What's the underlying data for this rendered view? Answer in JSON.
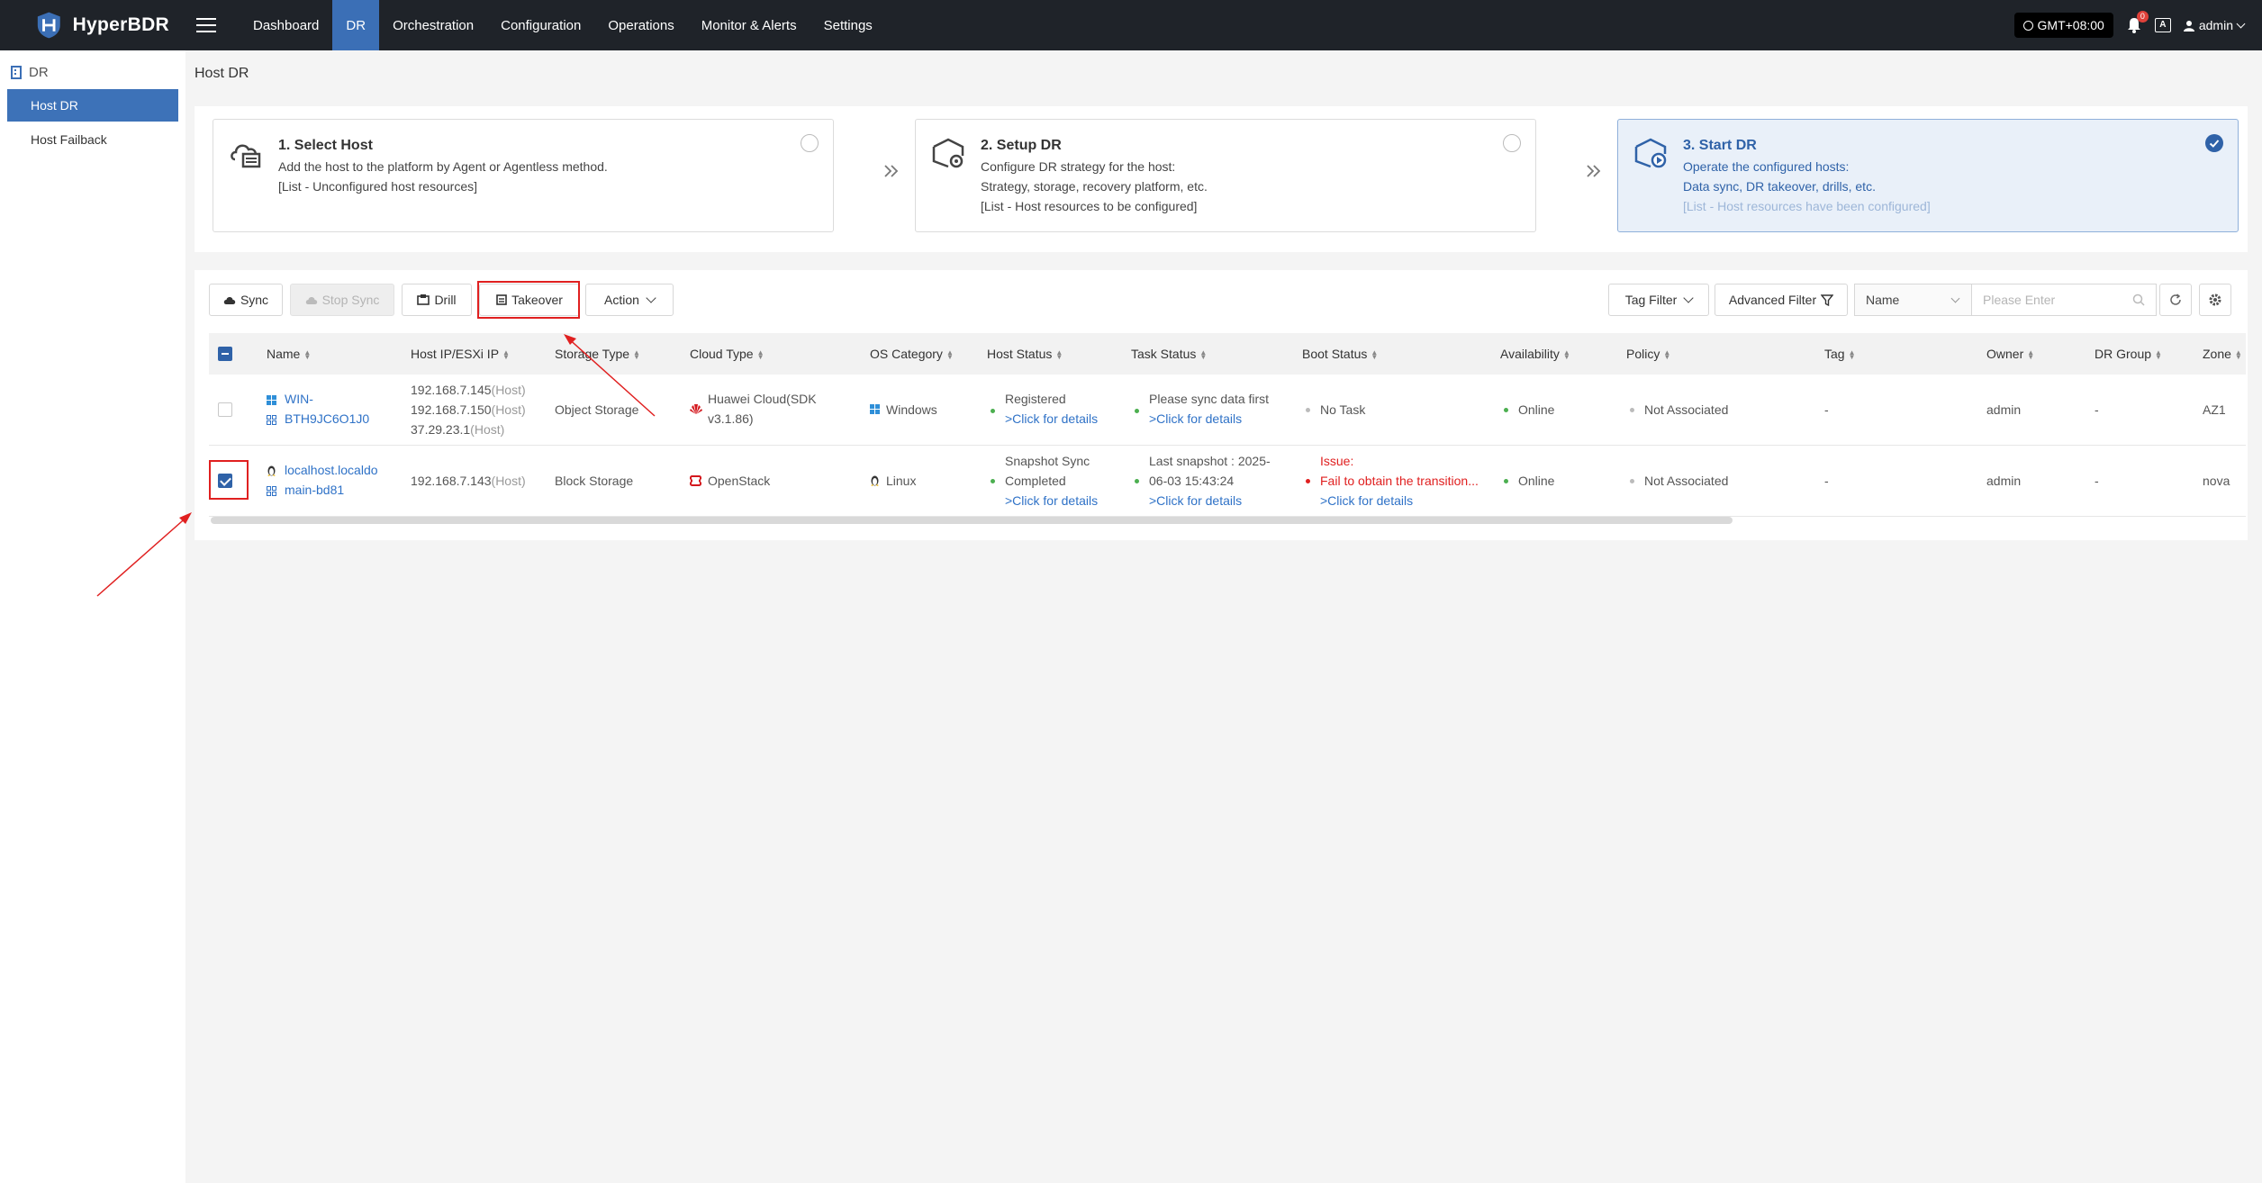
{
  "app": {
    "brand": "HyperBDR"
  },
  "nav": {
    "items": [
      "Dashboard",
      "DR",
      "Orchestration",
      "Configuration",
      "Operations",
      "Monitor & Alerts",
      "Settings"
    ],
    "active": "DR"
  },
  "topright": {
    "timezone": "GMT+08:00",
    "notification_count": "0",
    "lang_icon": "A",
    "user": "admin"
  },
  "sidebar": {
    "group": "DR",
    "items": [
      {
        "label": "Host DR",
        "active": true
      },
      {
        "label": "Host Failback",
        "active": false
      }
    ]
  },
  "page": {
    "title": "Host DR"
  },
  "steps": [
    {
      "title": "1. Select Host",
      "lines": [
        "Add the host to the platform by Agent or Agentless method.",
        "[List - Unconfigured host resources]"
      ],
      "checked": false
    },
    {
      "title": "2. Setup DR",
      "lines": [
        "Configure DR strategy for the host:",
        "Strategy, storage, recovery platform, etc.",
        "[List - Host resources to be configured]"
      ],
      "checked": false
    },
    {
      "title": "3. Start DR",
      "lines": [
        "Operate the configured hosts:",
        "Data sync, DR takeover, drills, etc.",
        "[List - Host resources have been configured]"
      ],
      "checked": true
    }
  ],
  "toolbar": {
    "sync": "Sync",
    "stop_sync": "Stop Sync",
    "drill": "Drill",
    "takeover": "Takeover",
    "action": "Action",
    "tag_filter": "Tag Filter",
    "advanced_filter": "Advanced Filter",
    "search_field": "Name",
    "search_placeholder": "Please Enter"
  },
  "table": {
    "columns": [
      "Name",
      "Host IP/ESXi IP",
      "Storage Type",
      "Cloud Type",
      "OS Category",
      "Host Status",
      "Task Status",
      "Boot Status",
      "Availability",
      "Policy",
      "Tag",
      "Owner",
      "DR Group",
      "Zone"
    ],
    "rows": [
      {
        "selected": false,
        "name_lines": [
          "WIN-",
          "BTH9JC6O1J0"
        ],
        "ips": [
          {
            "ip": "192.168.7.145",
            "kind": "(Host)"
          },
          {
            "ip": "192.168.7.150",
            "kind": "(Host)"
          },
          {
            "ip": "37.29.23.1",
            "kind": "(Host)"
          }
        ],
        "storage_type": "Object Storage",
        "cloud_type_lines": [
          "Huawei Cloud(SDK",
          "v3.1.86)"
        ],
        "os": "Windows",
        "host_status": "Registered",
        "host_status_link": ">Click for details",
        "task_status": "Please sync data first",
        "task_status_link": ">Click for details",
        "boot_status": "No Task",
        "availability": "Online",
        "policy": "Not Associated",
        "tag": "-",
        "owner": "admin",
        "dr_group": "-",
        "zone": "AZ1"
      },
      {
        "selected": true,
        "name_lines": [
          "localhost.localdo",
          "main-bd81"
        ],
        "ips": [
          {
            "ip": "192.168.7.143",
            "kind": "(Host)"
          }
        ],
        "storage_type": "Block Storage",
        "cloud_type": "OpenStack",
        "os": "Linux",
        "host_status_lines": [
          "Snapshot Sync",
          "Completed"
        ],
        "host_status_link": ">Click for details",
        "task_status_lines": [
          "Last snapshot : 2025-",
          "06-03 15:43:24"
        ],
        "task_status_link": ">Click for details",
        "boot_issue_label": "Issue:",
        "boot_issue": "Fail to obtain the transition...",
        "boot_status_link": ">Click for details",
        "availability": "Online",
        "policy": "Not Associated",
        "tag": "-",
        "owner": "admin",
        "dr_group": "-",
        "zone": "nova"
      }
    ]
  },
  "colors": {
    "topbar": "#1f2329",
    "active_nav": "#3b6fb6",
    "accent": "#2f62a8",
    "link": "#2f72c7",
    "error": "#e02020",
    "online": "#4caf50",
    "annotation": "#e02020"
  }
}
